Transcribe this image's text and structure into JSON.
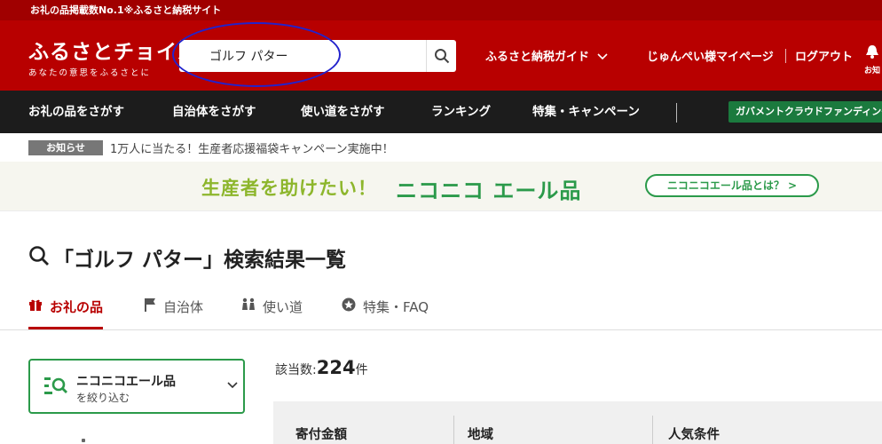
{
  "topbar": {
    "text": "お礼の品掲載数No.1※ふるさと納税サイト"
  },
  "header": {
    "logo_main": "ふるさとチョイス",
    "logo_sub": "あなたの意思をふるさとに",
    "search_value": "ゴルフ パター",
    "guide_label": "ふるさと納税ガイド",
    "mypage_label": "じゅんぺい様マイページ",
    "logout_label": "ログアウト",
    "cut_icon_label": "お知"
  },
  "nav": {
    "items": [
      "お礼の品をさがす",
      "自治体をさがす",
      "使い道をさがす",
      "ランキング",
      "特集・キャンペーン"
    ],
    "gov_label": "ガバメントクラウドファンディング"
  },
  "notice": {
    "badge": "お知らせ",
    "text": "1万人に当たる！生産者応援福袋キャンペーン実施中！"
  },
  "banner": {
    "lead": "生産者を助けたい！",
    "title": "ニコニコ エール品",
    "button": "ニコニコエール品とは？ >"
  },
  "search_results": {
    "title": "「ゴルフ パター」検索結果一覧",
    "tabs": [
      {
        "label": "お礼の品",
        "icon": "gift-icon"
      },
      {
        "label": "自治体",
        "icon": "flag-icon"
      },
      {
        "label": "使い道",
        "icon": "people-icon"
      },
      {
        "label": "特集・FAQ",
        "icon": "star-badge-icon"
      }
    ],
    "filter_title": "ニコニコエール品",
    "filter_sub": "を絞り込む",
    "count_prefix": "該当数:",
    "count_value": "224",
    "count_suffix": "件",
    "columns": [
      "寄付金額",
      "地域",
      "人気条件"
    ]
  },
  "colors": {
    "brand": "#b80000",
    "accent_green": "#2b9a4a",
    "nav_bg": "#1c1c1c"
  }
}
